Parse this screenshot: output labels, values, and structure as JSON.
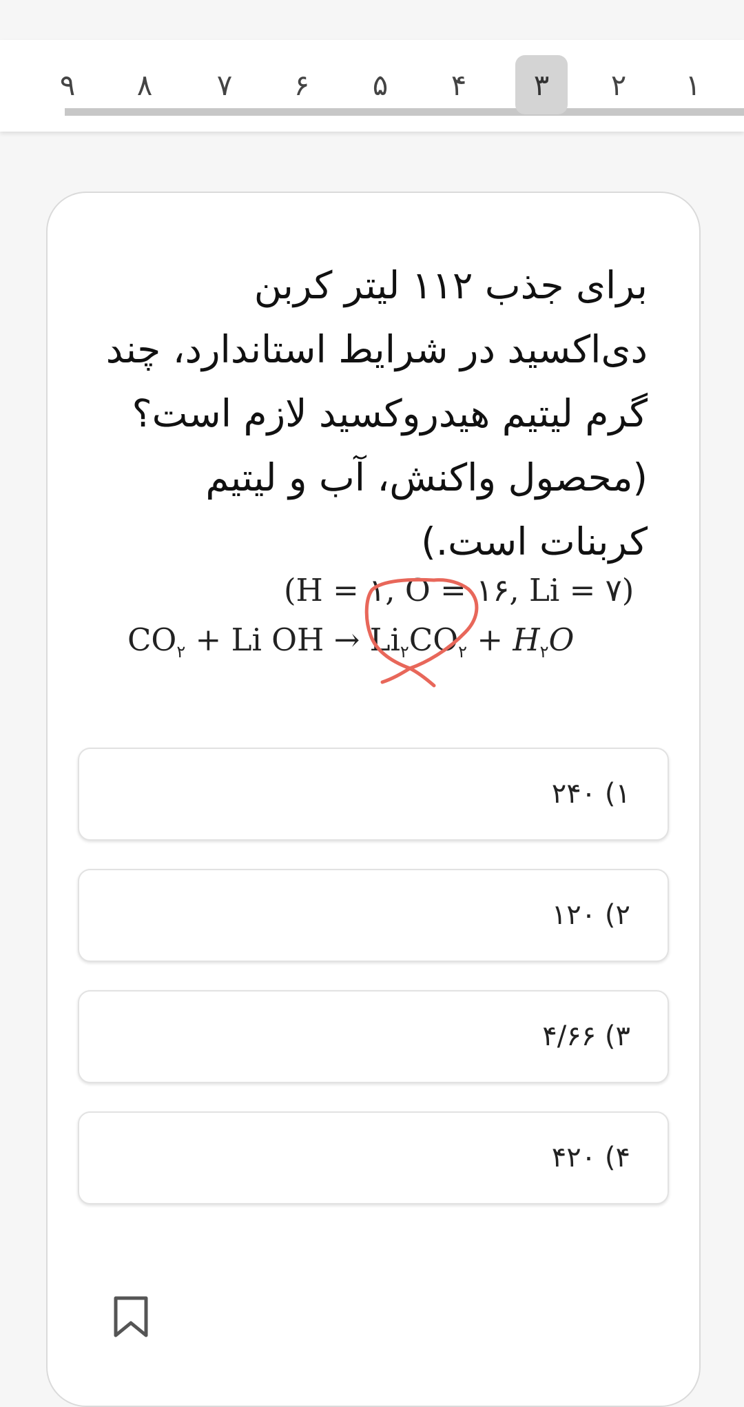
{
  "nav": {
    "tabs": [
      {
        "label": "۹",
        "active": false
      },
      {
        "label": "۸",
        "active": false
      },
      {
        "label": "۷",
        "active": false
      },
      {
        "label": "۶",
        "active": false
      },
      {
        "label": "۵",
        "active": false
      },
      {
        "label": "۴",
        "active": false
      },
      {
        "label": "۳",
        "active": true
      },
      {
        "label": "۲",
        "active": false
      },
      {
        "label": "۱",
        "active": false
      }
    ]
  },
  "question": {
    "text": "برای جذب ۱۱۲ لیتر کربن دی‌اکسید در شرایط استاندارد، چند گرم لیتیم هیدروکسید لازم است؟ (محصول واکنش، آب و لیتیم کربنات است.)",
    "atomic_masses": "(H = ۱, O = ۱۶, Li = ۷)",
    "equation": {
      "reactant1": "CO",
      "reactant1_sub": "۲",
      "plus1": "+",
      "reactant2": "Li OH",
      "arrow": "→",
      "product1_a": "Li",
      "product1_a_sub": "۲",
      "product1_b": "CO",
      "product1_b_sub": "۲",
      "plus2": "+",
      "product2_a": "H",
      "product2_sub": "۲",
      "product2_b": "O"
    }
  },
  "options": [
    {
      "label": "۱) ۲۴۰"
    },
    {
      "label": "۲) ۱۲۰"
    },
    {
      "label": "۳) ۴/۶۶"
    },
    {
      "label": "۴) ۴۲۰"
    }
  ],
  "colors": {
    "annotation_stroke": "#e8675a",
    "active_tab_bg": "#d4d4d4",
    "nav_track": "#c7c7c7"
  }
}
